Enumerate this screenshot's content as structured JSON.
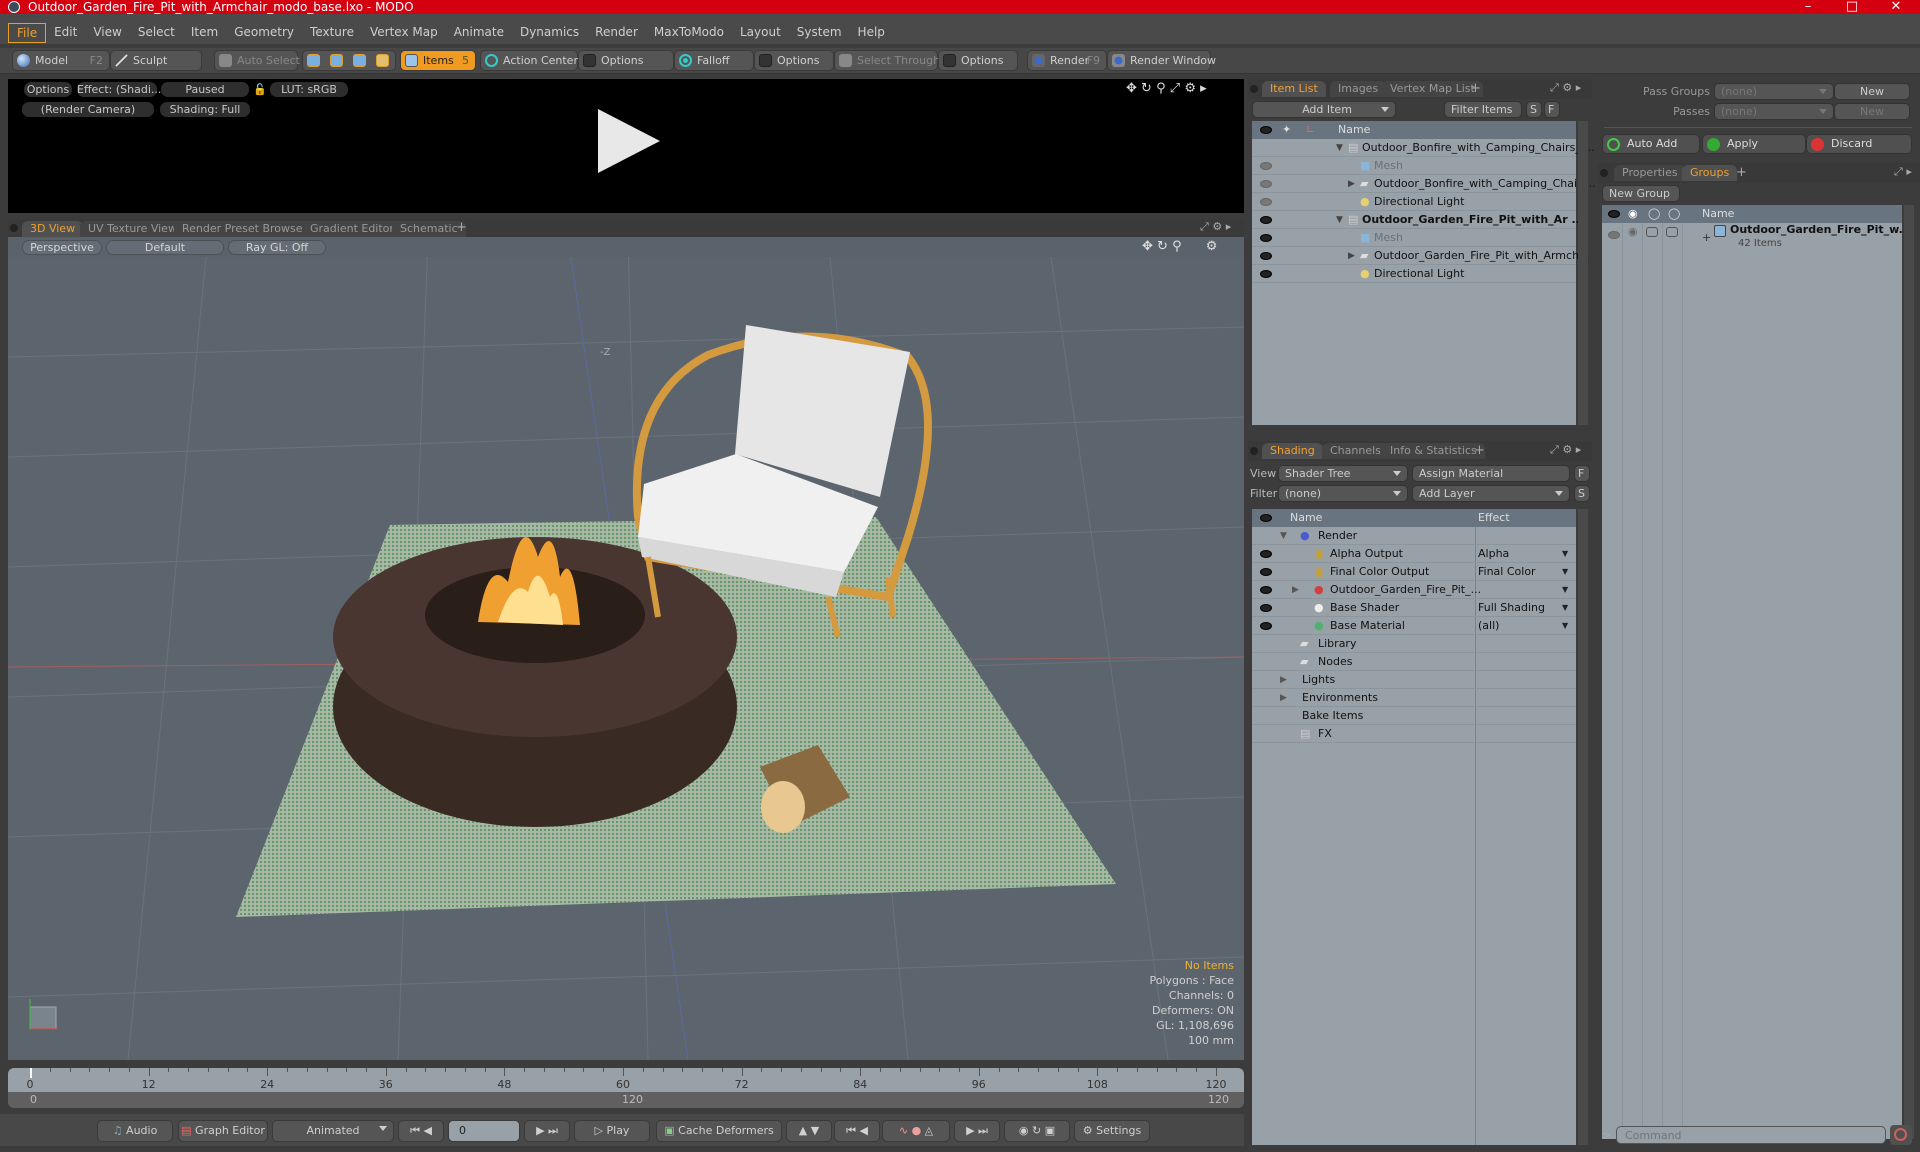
{
  "window": {
    "title": "Outdoor_Garden_Fire_Pit_with_Armchair_modo_base.lxo - MODO",
    "controls": [
      "minimize",
      "maximize",
      "close"
    ]
  },
  "menu": [
    "File",
    "Edit",
    "View",
    "Select",
    "Item",
    "Geometry",
    "Texture",
    "Vertex Map",
    "Animate",
    "Dynamics",
    "Render",
    "MaxToModo",
    "Layout",
    "System",
    "Help"
  ],
  "menu_active": "File",
  "toolbar": {
    "model": "Model",
    "model_key": "F2",
    "sculpt": "Sculpt",
    "auto_select": "Auto Select",
    "items": "Items",
    "items_key": "5",
    "action_center": "Action Center",
    "options1": "Options",
    "falloff": "Falloff",
    "options2": "Options",
    "select_through": "Select Through",
    "options3": "Options",
    "render": "Render",
    "render_key": "F9",
    "render_window": "Render Window"
  },
  "preview": {
    "options": "Options",
    "effect": "Effect: (Shadi...",
    "status": "Paused",
    "lut": "LUT: sRGB",
    "camera": "(Render Camera)",
    "shading": "Shading: Full"
  },
  "viewport_tabs": [
    "3D View",
    "UV Texture View",
    "Render Preset Browser",
    "Gradient Editor",
    "Schematic"
  ],
  "viewport_tab_active": "3D View",
  "viewport": {
    "projection": "Perspective",
    "style": "Default",
    "raygl": "Ray GL: Off",
    "axis_label": "-Z",
    "stats": {
      "selection": "No Items",
      "polygons": "Polygons : Face",
      "channels": "Channels: 0",
      "deformers": "Deformers: ON",
      "gl": "GL: 1,108,696",
      "unit": "100 mm"
    }
  },
  "timeline": {
    "ticks": [
      "0",
      "12",
      "24",
      "36",
      "48",
      "60",
      "72",
      "84",
      "96",
      "108",
      "120"
    ],
    "range_start": "0",
    "range_mid": "120",
    "range_end": "120"
  },
  "bottombar": {
    "audio": "Audio",
    "graph_editor": "Graph Editor",
    "animated": "Animated",
    "frame": "0",
    "play": "Play",
    "cache_deformers": "Cache Deformers",
    "settings": "Settings"
  },
  "item_list": {
    "tabs": [
      "Item List",
      "Images",
      "Vertex Map List"
    ],
    "active_tab": "Item List",
    "add_item": "Add Item",
    "filter": "Filter Items",
    "s": "S",
    "f": "F",
    "col_name": "Name",
    "rows": [
      {
        "label": "Outdoor_Bonfire_with_Camping_Chairs_ ...",
        "indent": 0,
        "type": "scene",
        "expand": "down",
        "eye": false,
        "bold": false,
        "dim": false
      },
      {
        "label": "Mesh",
        "indent": 1,
        "type": "mesh",
        "expand": "none",
        "eye": "dim",
        "bold": false,
        "dim": true
      },
      {
        "label": "Outdoor_Bonfire_with_Camping_Chair ...",
        "indent": 1,
        "type": "folder",
        "expand": "right",
        "eye": "dim",
        "bold": false,
        "dim": false
      },
      {
        "label": "Directional Light",
        "indent": 1,
        "type": "light",
        "expand": "none",
        "eye": "dim",
        "bold": false,
        "dim": false
      },
      {
        "label": "Outdoor_Garden_Fire_Pit_with_Ar ...",
        "indent": 0,
        "type": "scene",
        "expand": "down",
        "eye": true,
        "bold": true,
        "dim": false
      },
      {
        "label": "Mesh",
        "indent": 1,
        "type": "mesh",
        "expand": "none",
        "eye": true,
        "bold": false,
        "dim": true
      },
      {
        "label": "Outdoor_Garden_Fire_Pit_with_Armch...",
        "indent": 1,
        "type": "folder",
        "expand": "right",
        "eye": true,
        "bold": false,
        "dim": false
      },
      {
        "label": "Directional Light",
        "indent": 1,
        "type": "light",
        "expand": "none",
        "eye": true,
        "bold": false,
        "dim": false
      }
    ]
  },
  "shading": {
    "tabs": [
      "Shading",
      "Channels",
      "Info & Statistics"
    ],
    "active_tab": "Shading",
    "view_label": "View",
    "view_value": "Shader Tree",
    "assign_material": "Assign Material",
    "f": "F",
    "filter_label": "Filter",
    "filter_value": "(none)",
    "add_layer": "Add Layer",
    "s": "S",
    "col_name": "Name",
    "col_effect": "Effect",
    "rows": [
      {
        "label": "Render",
        "effect": "",
        "indent": 0,
        "type": "render",
        "eye": false,
        "expand": "down"
      },
      {
        "label": "Alpha Output",
        "effect": "Alpha",
        "indent": 1,
        "type": "output",
        "eye": true,
        "expand": "none"
      },
      {
        "label": "Final Color Output",
        "effect": "Final Color",
        "indent": 1,
        "type": "output",
        "eye": true,
        "expand": "none"
      },
      {
        "label": "Outdoor_Garden_Fire_Pit_...",
        "effect": "",
        "indent": 1,
        "type": "material-group",
        "eye": true,
        "expand": "right"
      },
      {
        "label": "Base Shader",
        "effect": "Full Shading",
        "indent": 1,
        "type": "shader",
        "eye": true,
        "expand": "none"
      },
      {
        "label": "Base Material",
        "effect": "(all)",
        "indent": 1,
        "type": "material",
        "eye": true,
        "expand": "none"
      },
      {
        "label": "Library",
        "effect": "",
        "indent": 0,
        "type": "folder",
        "eye": false,
        "expand": "none"
      },
      {
        "label": "Nodes",
        "effect": "",
        "indent": 0,
        "type": "folder",
        "eye": false,
        "expand": "none"
      },
      {
        "label": "Lights",
        "effect": "",
        "indent": 0,
        "type": "none",
        "eye": false,
        "expand": "right"
      },
      {
        "label": "Environments",
        "effect": "",
        "indent": 0,
        "type": "none",
        "eye": false,
        "expand": "right"
      },
      {
        "label": "Bake Items",
        "effect": "",
        "indent": 0,
        "type": "none",
        "eye": false,
        "expand": "none"
      },
      {
        "label": "FX",
        "effect": "",
        "indent": 0,
        "type": "scene",
        "eye": false,
        "expand": "none"
      }
    ]
  },
  "passes": {
    "pass_groups_label": "Pass Groups",
    "pass_groups_value": "(none)",
    "passes_label": "Passes",
    "passes_value": "(none)",
    "new1": "New",
    "new2": "New",
    "auto_add": "Auto Add",
    "apply": "Apply",
    "discard": "Discard"
  },
  "groups": {
    "tabs": [
      "Properties",
      "Groups"
    ],
    "active_tab": "Groups",
    "new_group": "New Group",
    "col_name": "Name",
    "group_name": "Outdoor_Garden_Fire_Pit_w...",
    "group_count": "42 Items"
  },
  "command": {
    "prompt": ">",
    "placeholder": "Command"
  },
  "colors": {
    "title_bar": "#d40010",
    "accent_orange": "#f09a20",
    "viewport_bg": "#5c656d",
    "list_bg": "#98a0a8"
  }
}
